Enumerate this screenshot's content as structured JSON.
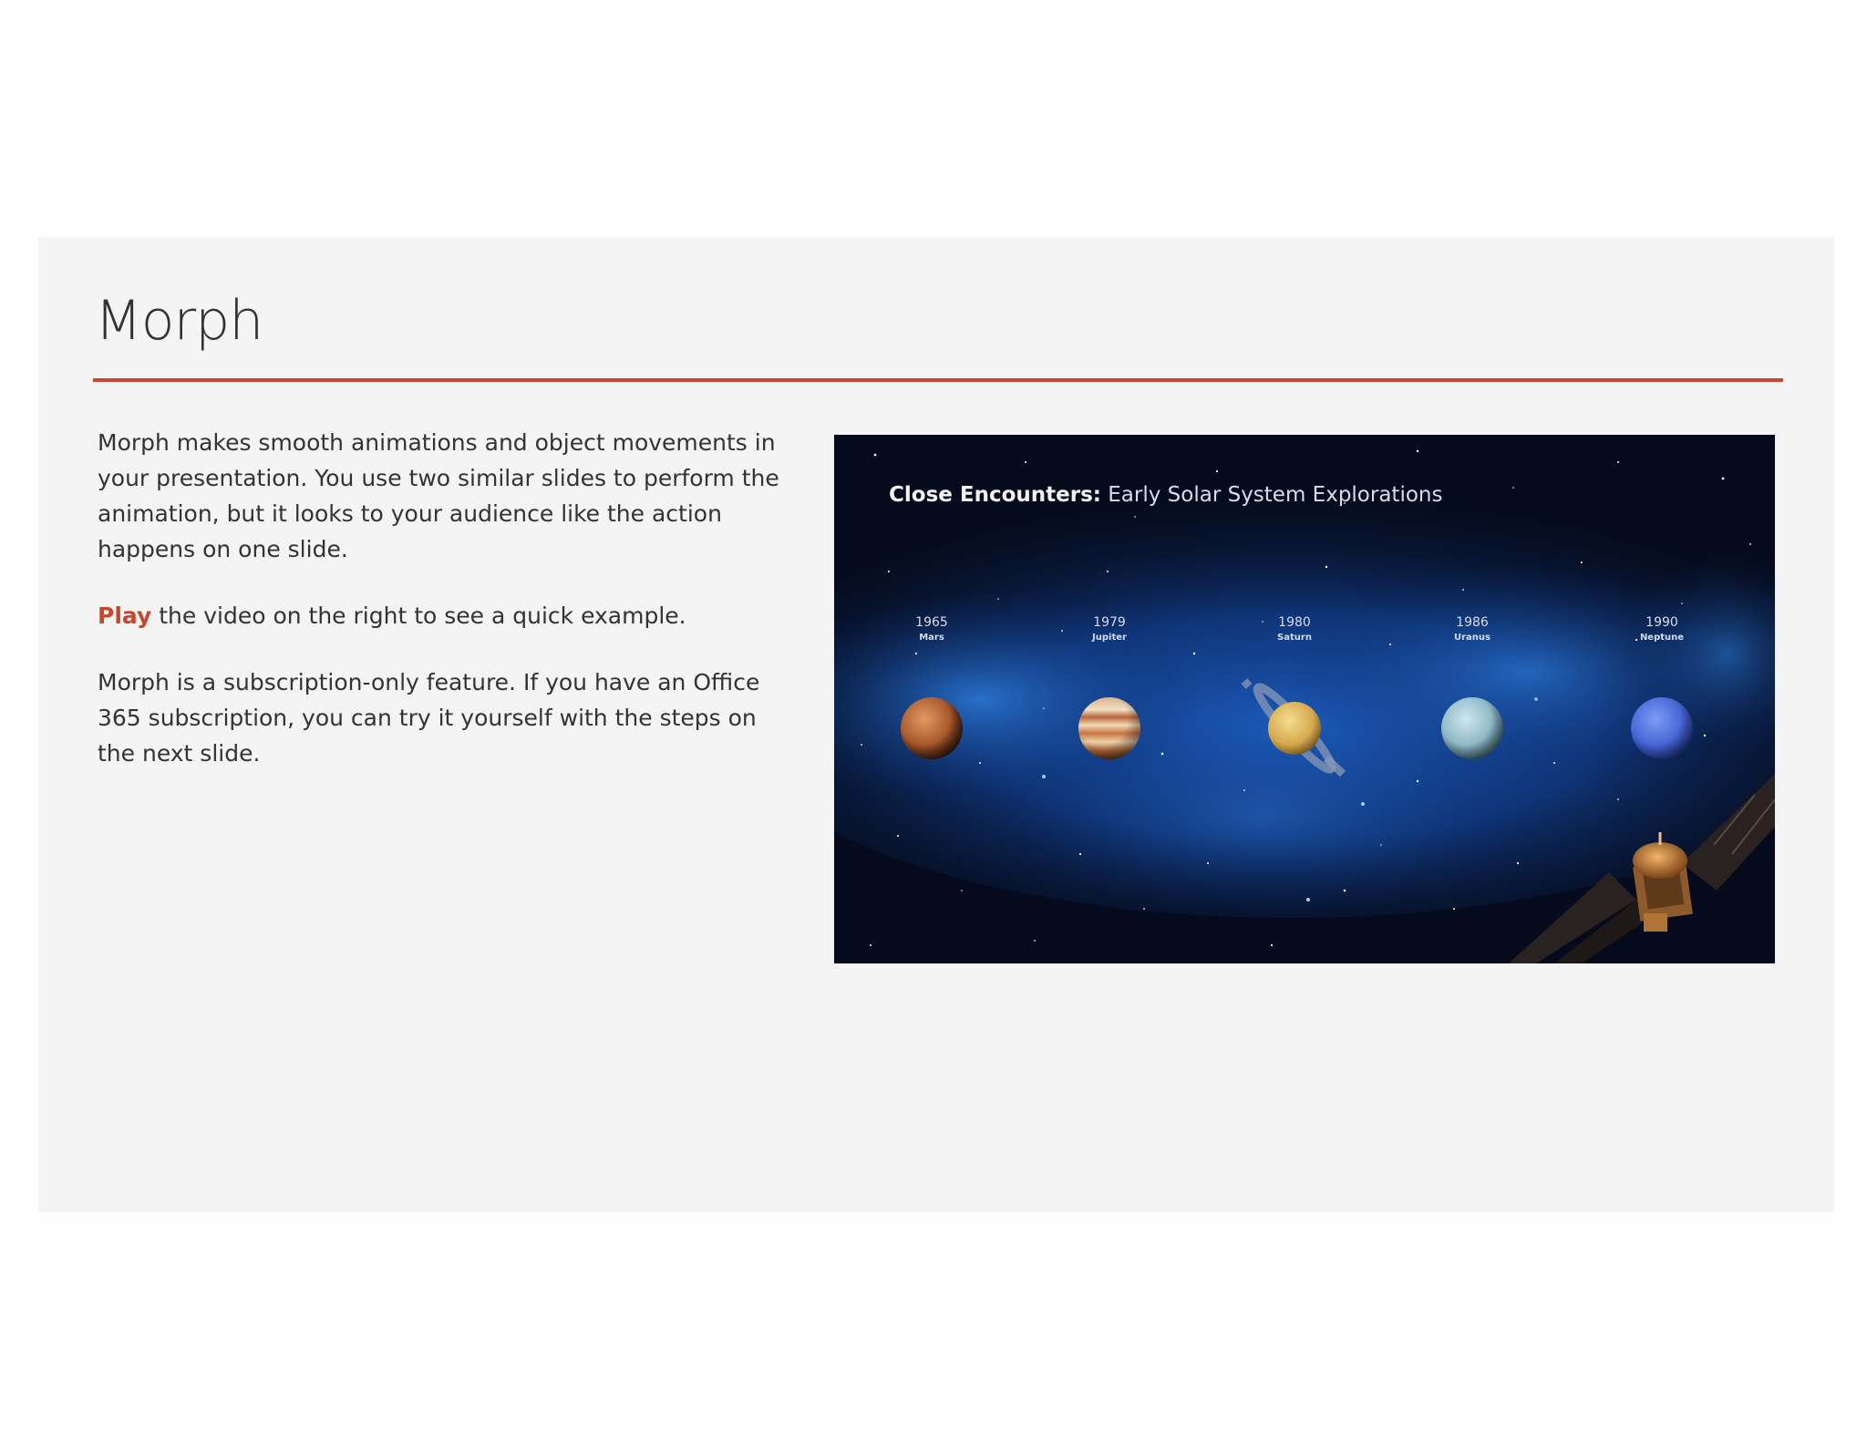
{
  "slide": {
    "title": "Morph",
    "paragraph1": "Morph makes smooth animations and object movements in your presentation. You use two similar slides to perform the animation, but it looks to your audience like the action happens on one slide.",
    "play_label": "Play",
    "paragraph2_rest": " the video on the right to see a quick example.",
    "paragraph3": "Morph is a subscription-only feature. If you have an Office 365 subscription, you can try it yourself with the steps on the next slide.",
    "accent_color": "#c8462b"
  },
  "video": {
    "title_bold": "Close Encounters:",
    "title_rest": " Early Solar System Explorations",
    "planets": [
      {
        "year": "1965",
        "name": "Mars"
      },
      {
        "year": "1979",
        "name": "Jupiter"
      },
      {
        "year": "1980",
        "name": "Saturn"
      },
      {
        "year": "1986",
        "name": "Uranus"
      },
      {
        "year": "1990",
        "name": "Neptune"
      }
    ]
  }
}
